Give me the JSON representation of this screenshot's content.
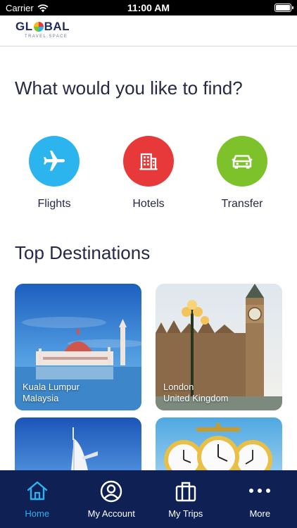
{
  "status_bar": {
    "carrier": "Carrier",
    "time": "11:00 AM"
  },
  "header": {
    "logo_pre": "GL",
    "logo_post": "BAL",
    "logo_sub": "TRAVEL.SPACE"
  },
  "find": {
    "title": "What would you like to find?",
    "categories": [
      {
        "label": "Flights",
        "color": "#2cb4ef",
        "icon": "airplane-icon"
      },
      {
        "label": "Hotels",
        "color": "#e8393a",
        "icon": "building-icon"
      },
      {
        "label": "Transfer",
        "color": "#7dc22b",
        "icon": "car-icon"
      }
    ]
  },
  "destinations": {
    "title": "Top Destinations",
    "items": [
      {
        "city": "Kuala Lumpur",
        "country": "Malaysia"
      },
      {
        "city": "London",
        "country": "United Kingdom"
      },
      {
        "city": "",
        "country": ""
      },
      {
        "city": "",
        "country": ""
      }
    ]
  },
  "tab_bar": {
    "active_color": "#2fb3ee",
    "tabs": [
      {
        "label": "Home",
        "icon": "home-icon",
        "active": true
      },
      {
        "label": "My Account",
        "icon": "account-icon",
        "active": false
      },
      {
        "label": "My Trips",
        "icon": "luggage-icon",
        "active": false
      },
      {
        "label": "More",
        "icon": "more-icon",
        "active": false
      }
    ]
  }
}
